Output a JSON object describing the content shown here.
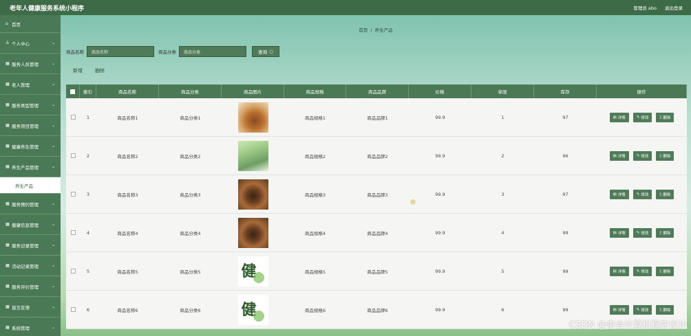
{
  "app": {
    "title": "老年人健康服务系统小程序"
  },
  "header": {
    "admin_label": "管理员 abo",
    "logout_label": "退出登录"
  },
  "sidebar": {
    "items": [
      {
        "label": "首页",
        "icon": "home-icon",
        "glyph": "⌂"
      },
      {
        "label": "个人中心",
        "icon": "person-icon",
        "glyph": "♙"
      },
      {
        "label": "服务人员管理",
        "icon": "grid-icon",
        "glyph": "▦"
      },
      {
        "label": "老人管理",
        "icon": "grid-icon",
        "glyph": "▦"
      },
      {
        "label": "服务类型管理",
        "icon": "grid-icon",
        "glyph": "▦"
      },
      {
        "label": "服务项目管理",
        "icon": "grid-icon",
        "glyph": "▦"
      },
      {
        "label": "健康养生管理",
        "icon": "grid-icon",
        "glyph": "▦"
      },
      {
        "label": "养生产品管理",
        "icon": "grid-icon",
        "glyph": "▦"
      },
      {
        "label": "服务预约管理",
        "icon": "grid-icon",
        "glyph": "▦"
      },
      {
        "label": "健康信息管理",
        "icon": "grid-icon",
        "glyph": "▦"
      },
      {
        "label": "服务记录管理",
        "icon": "grid-icon",
        "glyph": "▦"
      },
      {
        "label": "活动记录管理",
        "icon": "grid-icon",
        "glyph": "▦"
      },
      {
        "label": "服务评价管理",
        "icon": "grid-icon",
        "glyph": "▦"
      },
      {
        "label": "留言反馈",
        "icon": "grid-icon",
        "glyph": "▦"
      },
      {
        "label": "系统管理",
        "icon": "grid-icon",
        "glyph": "▦"
      }
    ],
    "submenu_active": "养生产品"
  },
  "breadcrumb": {
    "home": "首页",
    "separator": "/",
    "current": "养生产品"
  },
  "search": {
    "name_label": "商品名称",
    "name_placeholder": "商品名称",
    "category_label": "商品分类",
    "category_placeholder": "商品分类",
    "query_label": "查询"
  },
  "actions": {
    "add": "新增",
    "delete": "删除"
  },
  "table": {
    "headers": [
      "索引",
      "商品名称",
      "商品分类",
      "商品图片",
      "商品规格",
      "商品品牌",
      "价格",
      "单限",
      "库存",
      "操作"
    ],
    "rows": [
      {
        "index": "1",
        "name": "商品名称1",
        "category": "商品分类1",
        "image": "food",
        "spec": "商品规格1",
        "brand": "商品品牌1",
        "price": "99.9",
        "limit": "1",
        "stock": "97"
      },
      {
        "index": "2",
        "name": "商品名称2",
        "category": "商品分类2",
        "image": "elder",
        "spec": "商品规格2",
        "brand": "商品品牌2",
        "price": "99.9",
        "limit": "2",
        "stock": "96"
      },
      {
        "index": "3",
        "name": "商品名称3",
        "category": "商品分类3",
        "image": "bowl",
        "spec": "商品规格3",
        "brand": "商品品牌3",
        "price": "99.9",
        "limit": "3",
        "stock": "97"
      },
      {
        "index": "4",
        "name": "商品名称4",
        "category": "商品分类4",
        "image": "bowl",
        "spec": "商品规格4",
        "brand": "商品品牌4",
        "price": "99.9",
        "limit": "4",
        "stock": "99"
      },
      {
        "index": "5",
        "name": "商品名称5",
        "category": "商品分类5",
        "image": "callig",
        "spec": "商品规格5",
        "brand": "商品品牌5",
        "price": "99.9",
        "limit": "5",
        "stock": "99"
      },
      {
        "index": "6",
        "name": "商品名称6",
        "category": "商品分类6",
        "image": "callig",
        "spec": "商品规格6",
        "brand": "商品品牌6",
        "price": "99.9",
        "limit": "6",
        "stock": "99"
      }
    ],
    "ops": {
      "detail": "详情",
      "edit": "修改",
      "delete": "删除"
    }
  },
  "calligraphy_glyph": "健",
  "watermark": "CSDN @李会计算机程序设计",
  "colors": {
    "primary": "#4a7a55",
    "dark": "#3d6b48",
    "button": "#4f7b59"
  }
}
